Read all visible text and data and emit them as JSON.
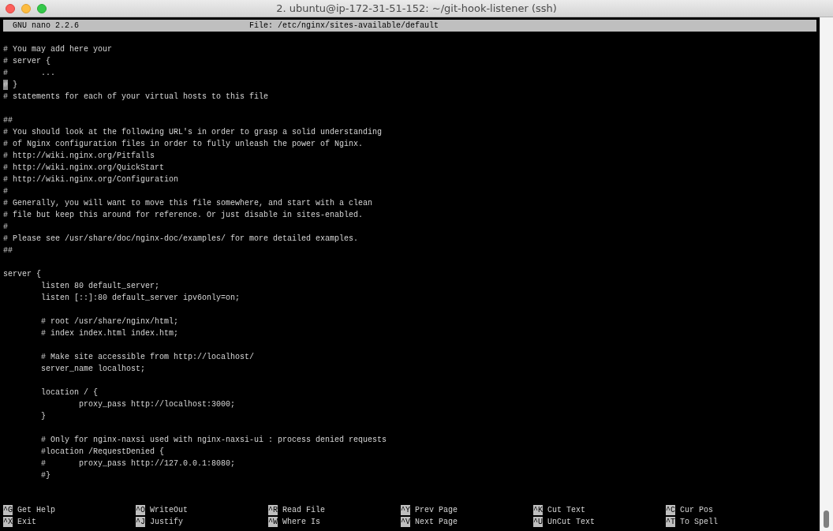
{
  "window": {
    "title": "2. ubuntu@ip-172-31-51-152: ~/git-hook-listener (ssh)"
  },
  "nano_header": {
    "version": "GNU nano 2.2.6",
    "file": "File: /etc/nginx/sites-available/default"
  },
  "editor_blocks": [
    [
      {
        "text": "# You may add here your",
        "cursor": false
      },
      {
        "text": "# server {",
        "cursor": false
      },
      {
        "text": "#\t...",
        "cursor": false
      },
      {
        "text": "# }",
        "cursor": true
      },
      {
        "text": "# statements for each of your virtual hosts to this file",
        "cursor": false
      }
    ],
    [
      {
        "text": "##",
        "cursor": false
      },
      {
        "text": "# You should look at the following URL's in order to grasp a solid understanding",
        "cursor": false
      },
      {
        "text": "# of Nginx configuration files in order to fully unleash the power of Nginx.",
        "cursor": false
      },
      {
        "text": "# http://wiki.nginx.org/Pitfalls",
        "cursor": false
      },
      {
        "text": "# http://wiki.nginx.org/QuickStart",
        "cursor": false
      },
      {
        "text": "# http://wiki.nginx.org/Configuration",
        "cursor": false
      },
      {
        "text": "#",
        "cursor": false
      },
      {
        "text": "# Generally, you will want to move this file somewhere, and start with a clean",
        "cursor": false
      },
      {
        "text": "# file but keep this around for reference. Or just disable in sites-enabled.",
        "cursor": false
      },
      {
        "text": "#",
        "cursor": false
      },
      {
        "text": "# Please see /usr/share/doc/nginx-doc/examples/ for more detailed examples.",
        "cursor": false
      },
      {
        "text": "##",
        "cursor": false
      }
    ],
    [
      {
        "text": "server {",
        "cursor": false
      },
      {
        "text": "\tlisten 80 default_server;",
        "cursor": false
      },
      {
        "text": "\tlisten [::]:80 default_server ipv6only=on;",
        "cursor": false
      }
    ],
    [
      {
        "text": "\t# root /usr/share/nginx/html;",
        "cursor": false
      },
      {
        "text": "\t# index index.html index.htm;",
        "cursor": false
      }
    ],
    [
      {
        "text": "\t# Make site accessible from http://localhost/",
        "cursor": false
      },
      {
        "text": "\tserver_name localhost;",
        "cursor": false
      }
    ],
    [
      {
        "text": "\tlocation / {",
        "cursor": false
      },
      {
        "text": "\t\tproxy_pass http://localhost:3000;",
        "cursor": false
      },
      {
        "text": "\t}",
        "cursor": false
      }
    ],
    [
      {
        "text": "\t# Only for nginx-naxsi used with nginx-naxsi-ui : process denied requests",
        "cursor": false
      },
      {
        "text": "\t#location /RequestDenied {",
        "cursor": false
      },
      {
        "text": "\t#\tproxy_pass http://127.0.0.1:8080;",
        "cursor": false
      },
      {
        "text": "\t#}",
        "cursor": false
      }
    ]
  ],
  "shortcut_rows": [
    [
      {
        "key": "^G",
        "label": "Get Help"
      },
      {
        "key": "^O",
        "label": "WriteOut"
      },
      {
        "key": "^R",
        "label": "Read File"
      },
      {
        "key": "^Y",
        "label": "Prev Page"
      },
      {
        "key": "^K",
        "label": "Cut Text"
      },
      {
        "key": "^C",
        "label": "Cur Pos"
      }
    ],
    [
      {
        "key": "^X",
        "label": "Exit"
      },
      {
        "key": "^J",
        "label": "Justify"
      },
      {
        "key": "^W",
        "label": "Where Is"
      },
      {
        "key": "^V",
        "label": "Next Page"
      },
      {
        "key": "^U",
        "label": "UnCut Text"
      },
      {
        "key": "^T",
        "label": "To Spell"
      }
    ]
  ]
}
